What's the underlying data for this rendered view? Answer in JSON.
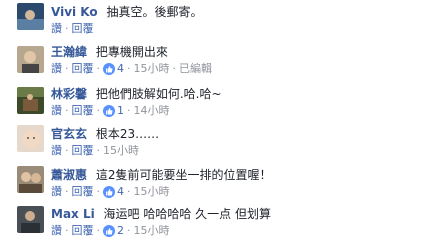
{
  "ui": {
    "like_label": "讚",
    "reply_label": "回覆",
    "edited_label": "已編輯",
    "separator": "·"
  },
  "comments": [
    {
      "author": "Vivi Ko",
      "text": "抽真空。後郵寄。",
      "likes": "",
      "time": "",
      "edited": false,
      "avatar_color": "#2b4a6e"
    },
    {
      "author": "王瀚緯",
      "text": "把專機開出來",
      "likes": "4",
      "time": "15小時",
      "edited": true,
      "avatar_color": "#8a7c6b"
    },
    {
      "author": "林彩馨",
      "text": "把他們肢解如何.哈.哈~",
      "likes": "1",
      "time": "14小時",
      "edited": false,
      "avatar_color": "#3d4a2a"
    },
    {
      "author": "官玄玄",
      "text": "根本23……",
      "likes": "",
      "time": "15小時",
      "edited": false,
      "avatar_color": "#c9b8a8"
    },
    {
      "author": "蕭淑惠",
      "text": "這2隻前可能要坐一排的位置喔！",
      "likes": "4",
      "time": "15小時",
      "edited": false,
      "avatar_color": "#6a5848"
    },
    {
      "author": "Max Li",
      "text": "海运吧 哈哈哈哈 久一点 但划算",
      "likes": "2",
      "time": "15小時",
      "edited": false,
      "avatar_color": "#4a4f55"
    }
  ]
}
